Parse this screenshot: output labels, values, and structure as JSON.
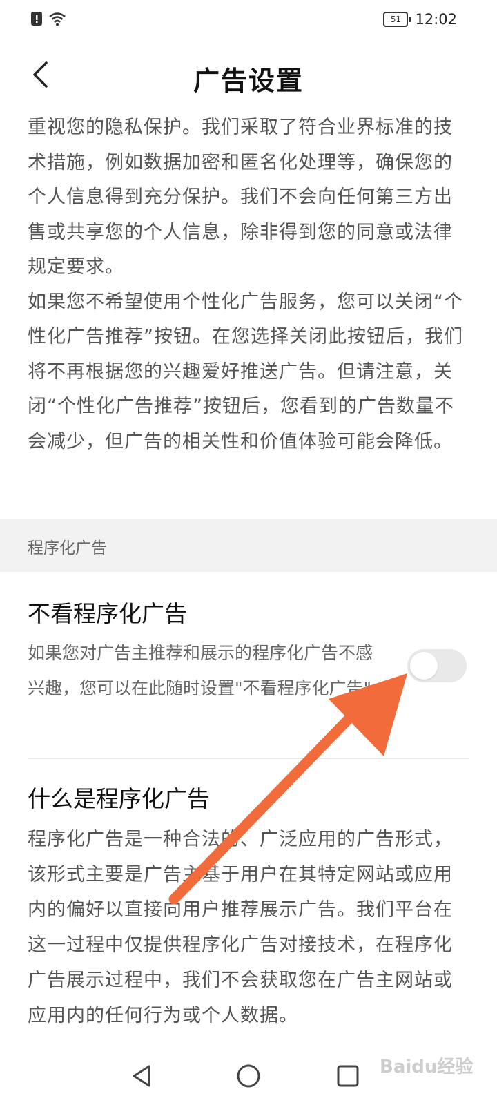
{
  "status_bar": {
    "battery": "51",
    "time": "12:02",
    "icons": [
      "alert-icon",
      "wifi-icon"
    ]
  },
  "header": {
    "title": "广告设置",
    "back_icon": "chevron-left-icon"
  },
  "intro": {
    "para1": "重视您的隐私保护。我们采取了符合业界标准的技术措施，例如数据加密和匿名化处理等，确保您的个人信息得到充分保护。我们不会向任何第三方出售或共享您的个人信息，除非得到您的同意或法律规定要求。",
    "para2": "如果您不希望使用个性化广告服务，您可以关闭“个性化广告推荐”按钮。在您选择关闭此按钮后，我们将不再根据您的兴趣爱好推送广告。但请注意，关闭“个性化广告推荐”按钮后，您看到的广告数量不会减少，但广告的相关性和价值体验可能会降低。"
  },
  "section": {
    "label": "程序化广告"
  },
  "setting_item": {
    "title": "不看程序化广告",
    "description": "如果您对广告主推荐和展示的程序化广告不感兴趣，您可以在此随时设置\"不看程序化广告\"",
    "toggle_on": false
  },
  "info_item": {
    "title": "什么是程序化广告",
    "description": "程序化广告是一种合法的、广泛应用的广告形式，该形式主要是广告主基于用户在其特定网站或应用内的偏好以直接向用户推荐展示广告。我们平台在这一过程中仅提供程序化广告对接技术，在程序化广告展示过程中，我们不会获取您在广告主网站或应用内的任何行为或个人数据。"
  },
  "annotation": {
    "arrow_color": "#f26b3a"
  },
  "nav_bar": {
    "buttons": [
      "back-triangle-icon",
      "home-circle-icon",
      "recents-square-icon"
    ]
  },
  "watermark": {
    "text": "Baidu经验"
  }
}
